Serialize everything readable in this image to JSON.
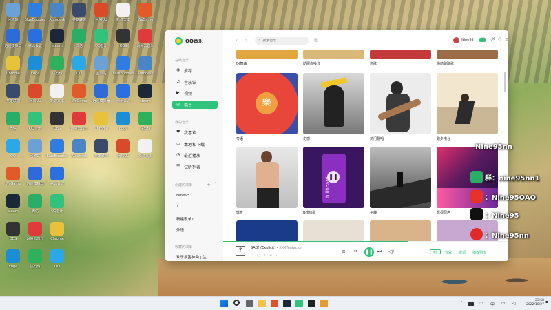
{
  "desktop": {
    "icons": [
      {
        "label": "回收站",
        "color": "#6aa2d8"
      },
      {
        "label": "BlueBubbles",
        "color": "#2f7de1"
      },
      {
        "label": "Autodesk",
        "color": "#4a86c6"
      },
      {
        "label": "英雄联盟",
        "color": "#3a4a6a"
      },
      {
        "label": "网易UU",
        "color": "#d84a2a"
      },
      {
        "label": "新建文本",
        "color": "#f1f1f1"
      },
      {
        "label": "WeGame",
        "color": "#e05a2a"
      },
      {
        "label": "逍遥模拟器",
        "color": "#2d6cd8"
      },
      {
        "label": "腾讯会议",
        "color": "#2a6fe0"
      },
      {
        "label": "steam",
        "color": "#1b2838"
      },
      {
        "label": "微信",
        "color": "#2aae67"
      },
      {
        "label": "QQ音乐",
        "color": "#31c27c"
      },
      {
        "label": "OBS",
        "color": "#333333"
      },
      {
        "label": "网易云音乐",
        "color": "#e03a3a"
      },
      {
        "label": "Chrome",
        "color": "#e8c23a"
      },
      {
        "label": "Edge",
        "color": "#1b8fd6"
      },
      {
        "label": "快剪辑",
        "color": "#2fb05c"
      },
      {
        "label": "QQ",
        "color": "#2aa8e8"
      }
    ]
  },
  "app": {
    "logo_text": "QQ音乐",
    "sidebar": {
      "section_online": "在线音乐",
      "online_items": [
        {
          "label": "推荐",
          "icon": "◉"
        },
        {
          "label": "音乐馆",
          "icon": "♫"
        },
        {
          "label": "视频",
          "icon": "▶"
        },
        {
          "label": "电台",
          "icon": "◎"
        }
      ],
      "section_mine": "我的音乐",
      "mine_items": [
        {
          "label": "我喜欢",
          "icon": "♥"
        },
        {
          "label": "本地和下载",
          "icon": "▭"
        },
        {
          "label": "最近播放",
          "icon": "◔"
        },
        {
          "label": "试听列表",
          "icon": "☰"
        }
      ],
      "section_created": "创建的歌单",
      "created_items": [
        "Nine95",
        "1",
        "新建歌单1",
        "外语"
      ],
      "section_fav": "收藏的歌单",
      "fav_items": [
        "欢乐氛围神曲 | 生..."
      ]
    },
    "topbar": {
      "search_placeholder": "搜索音乐",
      "username": "Nine95"
    },
    "grid": {
      "row0": [
        "DJ舞曲",
        "助眠白噪音",
        "热歌",
        "睡前聊聊歌"
      ],
      "row1": [
        "粤语",
        "伤感",
        "热门翻唱",
        "跑步电台"
      ],
      "row2": [
        "健身",
        "B榜热歌",
        "平静",
        "影视原声"
      ]
    },
    "player": {
      "song": "SAD! (Explicit)",
      "artist": "XXXTentacion",
      "cover_glyph": "?",
      "quality": "标准",
      "progress": 0.65,
      "right_labels": [
        "音效",
        "歌词",
        "播放列表"
      ]
    }
  },
  "overlay": {
    "name": "Nine95nn",
    "wechat": "群：nine95nn1",
    "weibo": "：Nine95OAO",
    "douyin": "：Nine95",
    "netease": "：Nine95nn"
  },
  "taskbar": {
    "time": "23:58",
    "date": "2022/10/27",
    "ime": "中"
  },
  "colors": {
    "accent": "#31c27c"
  }
}
